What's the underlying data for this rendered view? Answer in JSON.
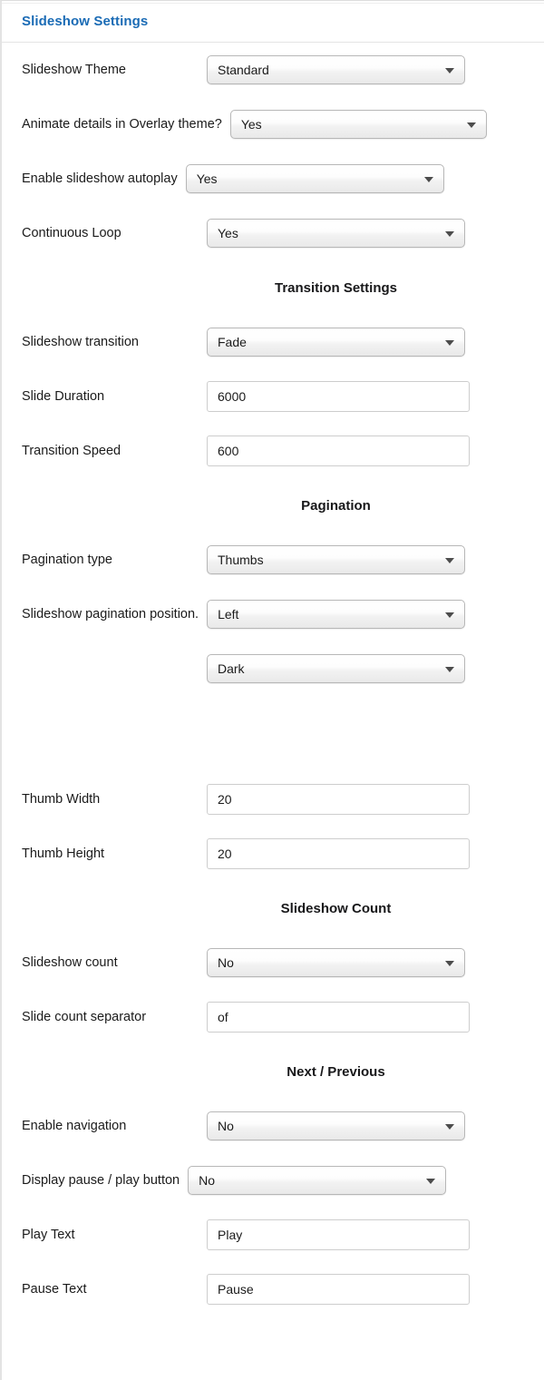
{
  "panel": {
    "header_title": "Slideshow Settings",
    "accent_color": "#1a6bb5",
    "heading_color": "#18181a",
    "label_color": "#1b1b1b"
  },
  "rows": {
    "slideshow_theme": {
      "label": "Slideshow Theme",
      "value": "Standard"
    },
    "animate_details": {
      "label": "Animate details in Overlay theme?",
      "value": "Yes"
    },
    "enable_autoplay": {
      "label": "Enable slideshow autoplay",
      "value": "Yes"
    },
    "continuous_loop": {
      "label": "Continuous Loop",
      "value": "Yes"
    },
    "transition_heading": {
      "label": "Transition Settings"
    },
    "slideshow_transition": {
      "label": "Slideshow transition",
      "value": "Fade"
    },
    "slide_duration": {
      "label": "Slide Duration",
      "value": "6000"
    },
    "transition_speed": {
      "label": "Transition Speed",
      "value": "600"
    },
    "pagination_heading": {
      "label": "Pagination"
    },
    "pagination_type": {
      "label": "Pagination type",
      "value": "Thumbs"
    },
    "pagination_position": {
      "label": "Slideshow pagination position.",
      "value": "Left"
    },
    "pagination_style": {
      "label": "",
      "value": "Dark"
    },
    "thumb_width": {
      "label": "Thumb Width",
      "value": "20"
    },
    "thumb_height": {
      "label": "Thumb Height",
      "value": "20"
    },
    "count_heading": {
      "label": "Slideshow Count"
    },
    "slideshow_count": {
      "label": "Slideshow count",
      "value": "No"
    },
    "slide_count_separator": {
      "label": "Slide count separator",
      "value": "of"
    },
    "nextprev_heading": {
      "label": "Next / Previous"
    },
    "enable_navigation": {
      "label": "Enable navigation",
      "value": "No"
    },
    "display_pause_play": {
      "label": "Display pause / play button",
      "value": "No"
    },
    "play_text": {
      "label": "Play Text",
      "value": "Play"
    },
    "pause_text": {
      "label": "Pause Text",
      "value": "Pause"
    }
  },
  "icons": {
    "caret": "chevron-down-icon"
  }
}
